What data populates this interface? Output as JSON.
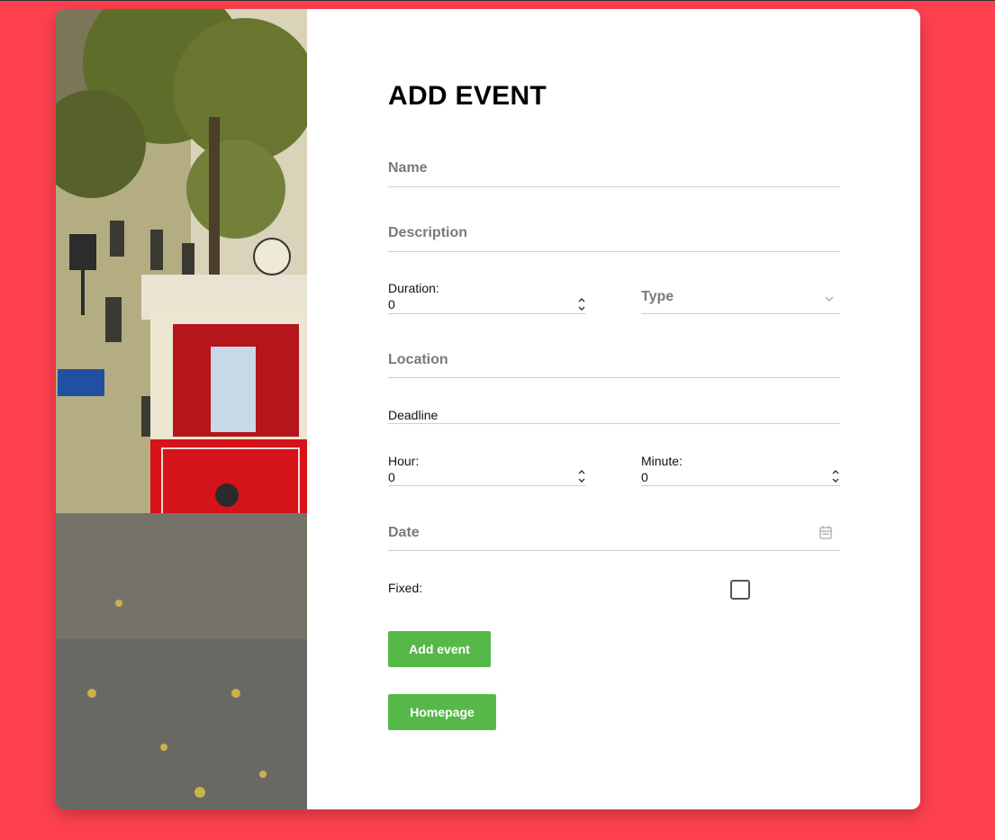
{
  "form": {
    "title": "ADD EVENT",
    "name_placeholder": "Name",
    "description_placeholder": "Description",
    "duration_label": "Duration:",
    "duration_value": "0",
    "type_placeholder": "Type",
    "location_placeholder": "Location",
    "deadline_label": "Deadline",
    "hour_label": "Hour:",
    "hour_value": "0",
    "minute_label": "Minute:",
    "minute_value": "0",
    "date_placeholder": "Date",
    "fixed_label": "Fixed:",
    "fixed_checked": false,
    "add_button": "Add event",
    "homepage_button": "Homepage"
  },
  "colors": {
    "background": "#ff414f",
    "card": "#ffffff",
    "button": "#56b848",
    "placeholder_text": "#7a7a7a"
  },
  "icons": {
    "type_select": "chevron-down-icon",
    "date_picker": "calendar-icon",
    "number_spinner": "spinner-arrows-icon"
  }
}
